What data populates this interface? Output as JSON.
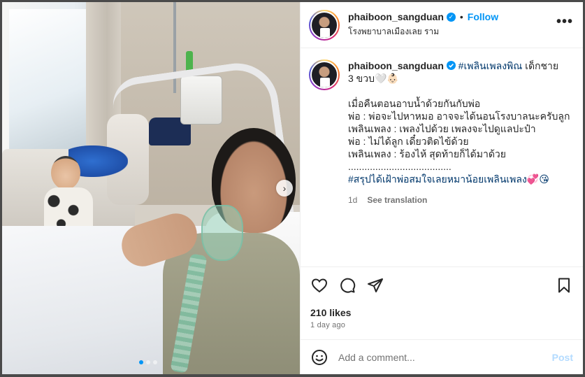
{
  "header": {
    "username": "phaiboon_sangduan",
    "verified_icon": "verified-badge-icon",
    "separator": "•",
    "follow_label": "Follow",
    "location": "โรงพยาบาลเมืองเลย ราม",
    "more_label": "•••"
  },
  "caption": {
    "username": "phaiboon_sangduan",
    "hashtag_title": "#เพลินเพลงพิณ",
    "title_rest": "เด็กชาย",
    "line2": "3 ขวบ🤍👶🏻",
    "lines": [
      "เมื่อคืนตอนอาบน้ำด้วยกันกับพ่อ",
      "พ่อ : พ่อจะไปหาหมอ อาจจะได้นอนโรงบาลนะครับลูก",
      "เพลินเพลง : เพลงไปด้วย เพลงจะไปดูแลปะป๋า",
      "พ่อ : ไม่ได้ลูก เดี๋ยวติดไข้ด้วย",
      "เพลินเพลง : ร้องไห้ สุดท้ายก็ได้มาด้วย",
      "......................................"
    ],
    "hashtag_footer": "#สรุปได้เฝ้าพ่อสมใจเลยหมาน้อยเพลินเพลง💞😘",
    "age": "1d",
    "translate_label": "See translation"
  },
  "actions": {
    "like_icon": "heart-icon",
    "comment_icon": "comment-icon",
    "share_icon": "share-icon",
    "save_icon": "bookmark-icon"
  },
  "stats": {
    "likes": "210 likes",
    "time": "1 day ago"
  },
  "comment": {
    "emoji_icon": "emoji-icon",
    "placeholder": "Add a comment...",
    "post_label": "Post"
  },
  "media": {
    "next_icon": "chevron-right-icon",
    "next_glyph": "›",
    "carousel_count": 3,
    "carousel_active": 0
  },
  "colors": {
    "accent": "#0095f6",
    "hashtag": "#00376b",
    "muted": "#737373",
    "post_disabled": "#b3dbff"
  }
}
